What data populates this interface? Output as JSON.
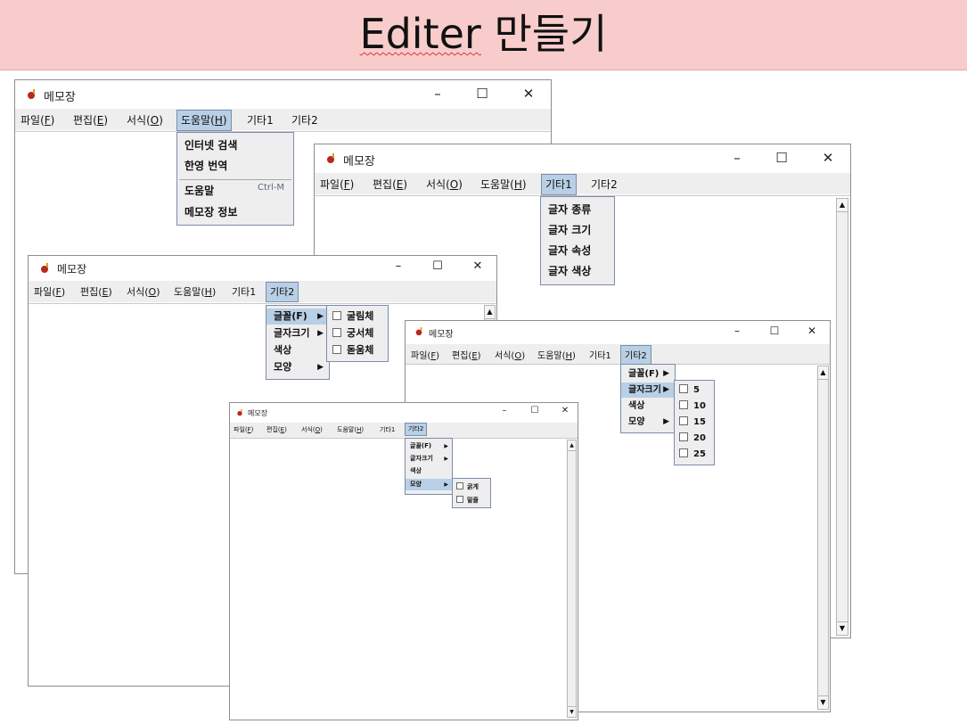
{
  "banner": {
    "title_en": "Editer",
    "title_ko": "만들기"
  },
  "app": {
    "title": "메모장"
  },
  "window_controls": {
    "minimize": "–",
    "maximize": "☐",
    "close": "✕"
  },
  "menu": {
    "file": "파일(",
    "file_mn": "F",
    "file_end": ")",
    "edit": "편집(",
    "edit_mn": "E",
    "edit_end": ")",
    "format": "서식(",
    "format_mn": "O",
    "format_end": ")",
    "help": "도움말(",
    "help_mn": "H",
    "help_end": ")",
    "etc1": "기타1",
    "etc2": "기타2"
  },
  "help_menu": {
    "items": [
      "인터넷 검색",
      "한영 번역",
      "도움말",
      "메모장 정보"
    ],
    "accel": "Ctrl-M"
  },
  "etc1_menu": {
    "items": [
      "글자 종류",
      "글자 크기",
      "글자 속성",
      "글자 색상"
    ]
  },
  "etc2_menu": {
    "items": [
      "글꼴(F)",
      "글자크기",
      "색상",
      "모양"
    ]
  },
  "font_submenu": {
    "items": [
      "굴림체",
      "궁서체",
      "돋움체"
    ]
  },
  "size_submenu": {
    "items": [
      "5",
      "10",
      "15",
      "20",
      "25"
    ]
  },
  "shape_submenu": {
    "items": [
      "굵게",
      "밑줄"
    ]
  },
  "colors": {
    "banner": "#f9cccc",
    "menu_highlight": "#b8cfe5",
    "menubar": "#eeeeee"
  },
  "icons": {
    "app": "notepad-app-icon",
    "submenu": "triangle-right-icon",
    "checkbox": "checkbox-icon"
  }
}
